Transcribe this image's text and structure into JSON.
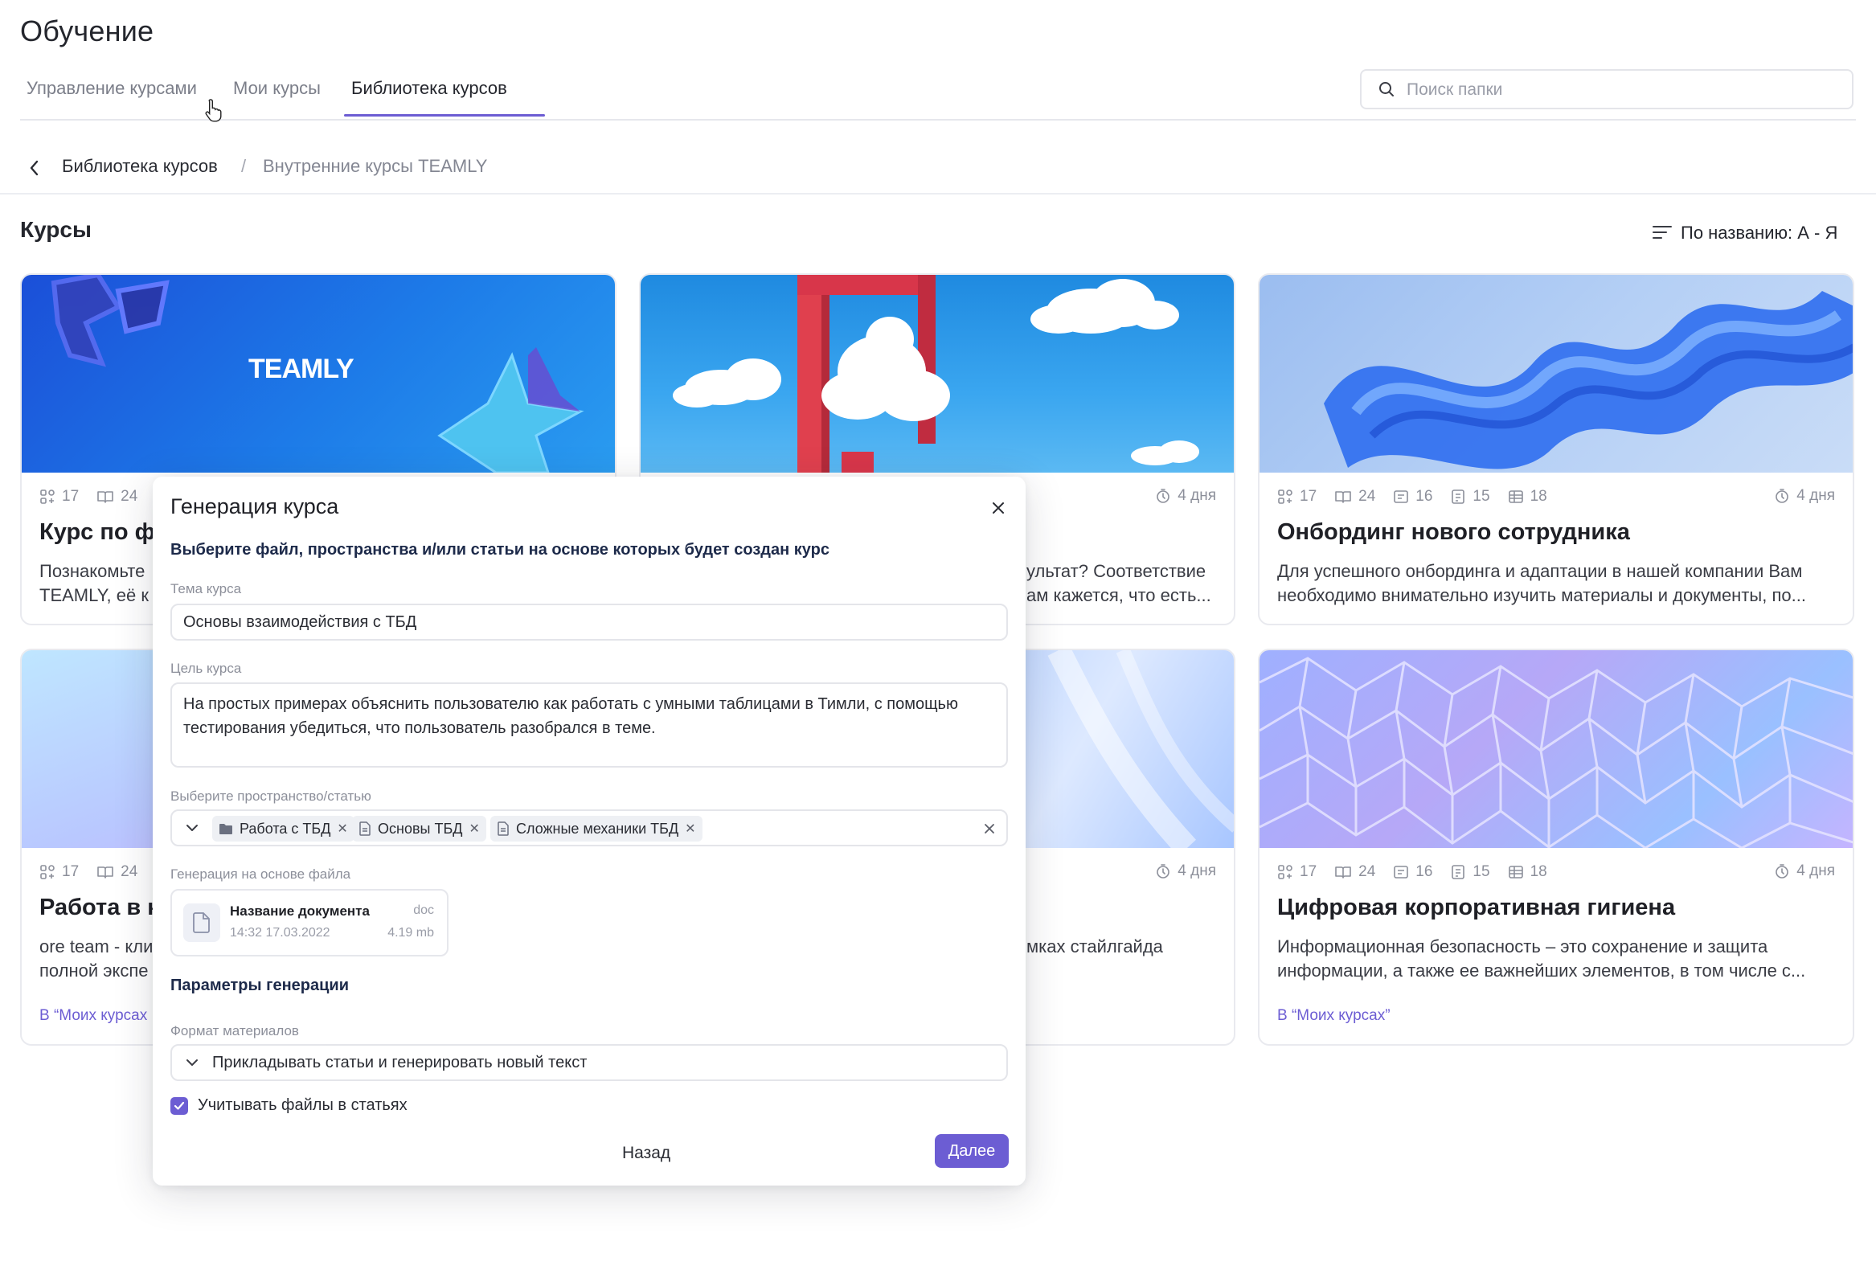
{
  "header": {
    "title": "Обучение",
    "tabs": [
      {
        "label": "Управление курсами"
      },
      {
        "label": "Мои курсы"
      },
      {
        "label": "Библиотека курсов"
      }
    ],
    "active_tab": "Библиотека курсов",
    "search_placeholder": "Поиск папки"
  },
  "breadcrumb": {
    "items": [
      "Библиотека курсов",
      "Внутренние курсы TEAMLY"
    ],
    "separator": "/"
  },
  "section": {
    "title": "Курсы",
    "sort_label": "По названию: А - Я"
  },
  "cards": [
    {
      "cover_text": "TEAMLY",
      "stats": [
        "17",
        "24"
      ],
      "title": "Курс по ф",
      "desc_lines": [
        "Познакомьте",
        "TEAMLY, её к"
      ]
    },
    {
      "duration": "4 дня",
      "desc_lines": [
        "ультат? Соответствие",
        "ам кажется, что есть..."
      ]
    },
    {
      "stats": [
        "17",
        "24",
        "16",
        "15",
        "18"
      ],
      "duration": "4 дня",
      "title": "Онбординг нового сотрудника",
      "desc_lines": [
        "Для успешного онбординга и адаптации в нашей компании Вам",
        "необходимо внимательно изучить материалы и документы, по..."
      ]
    },
    {
      "stats": [
        "17",
        "24"
      ],
      "title": "Работа в к",
      "desc_lines": [
        "ore team - кли",
        "полной экспе"
      ],
      "link": "В “Моих курсах"
    },
    {
      "duration": "4 дня",
      "desc_lines": [
        "мках стайлгайда"
      ]
    },
    {
      "stats": [
        "17",
        "24",
        "16",
        "15",
        "18"
      ],
      "duration": "4 дня",
      "title": "Цифровая корпоративная гигиена",
      "desc_lines": [
        "Информационная безопасность – это сохранение и защита",
        "информации, а также ее важнейших элементов, в том числе с..."
      ],
      "link": "В “Моих курсах”"
    }
  ],
  "modal": {
    "title": "Генерация курса",
    "subtitle": "Выберите файл, пространства и/или статьи на основе которых будет создан курс",
    "topic_label": "Тема курса",
    "topic_value": "Основы взаимодействия с ТБД",
    "goal_label": "Цель курса",
    "goal_value": "На простых примерах объяснить пользователю как работать с умными таблицами в Тимли, с помощью тестирования убедиться, что пользователь разобрался в теме.",
    "space_label": "Выберите пространство/статью",
    "chips": [
      {
        "label": "Работа с ТБД",
        "icon": "folder-icon"
      },
      {
        "label": "Основы ТБД",
        "icon": "document-icon"
      },
      {
        "label": "Сложные механики ТБД",
        "icon": "document-icon"
      }
    ],
    "file_label": "Генерация на основе файла",
    "file": {
      "name": "Название документа",
      "date": "14:32 17.03.2022",
      "ext": "doc",
      "size": "4.19 mb"
    },
    "params_title": "Параметры генерации",
    "format_label": "Формат материалов",
    "format_value": "Прикладывать статьи и генерировать новый текст",
    "checkbox_label": "Учитывать файлы в статьях",
    "checkbox_checked": true,
    "back_label": "Назад",
    "next_label": "Далее"
  },
  "colors": {
    "accent": "#6c5dd3",
    "text": "#1f2026",
    "muted": "#8c8f9a",
    "border": "#e4e5ea"
  }
}
